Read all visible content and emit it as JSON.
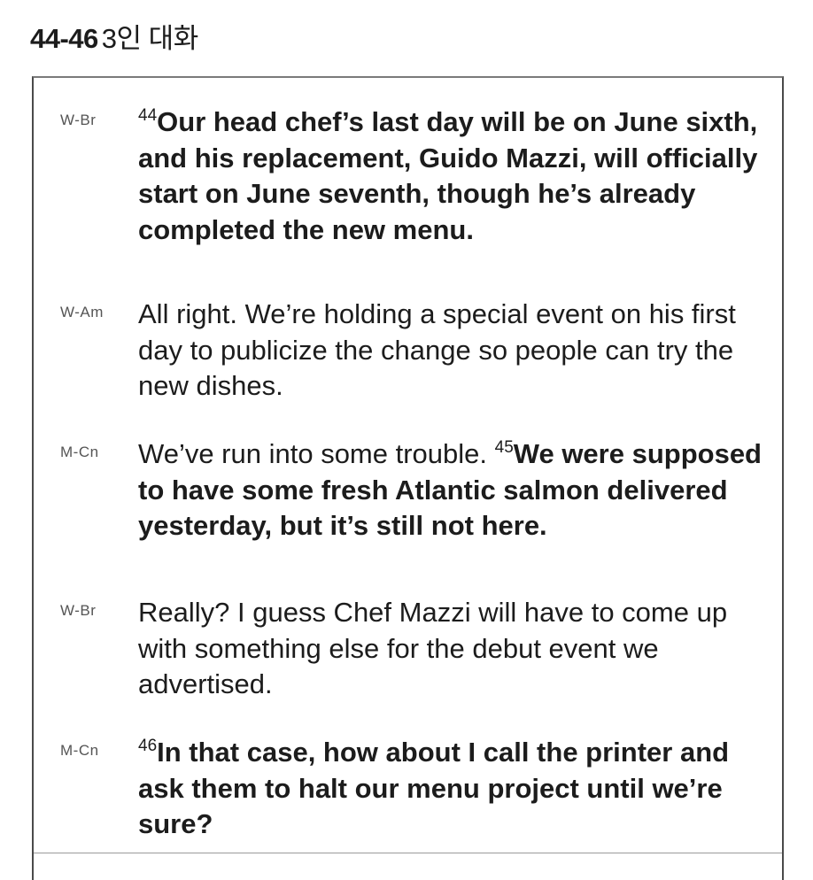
{
  "heading": {
    "number": "44-46",
    "title": "3인 대화"
  },
  "dialogue": [
    {
      "speaker": "W-Br",
      "ref": "44",
      "bold": "Our head chef’s last day will be on June sixth, and his replacement, Guido Mazzi, will officially start on June seventh, though he’s already completed the new menu.",
      "regular_before": "",
      "regular_after": ""
    },
    {
      "speaker": "W-Am",
      "ref": "",
      "bold": "",
      "regular_before": "All right. We’re holding a special event on his first day to publicize the change so people can try the new dishes.",
      "regular_after": ""
    },
    {
      "speaker": "M-Cn",
      "ref": "45",
      "bold": "We were supposed to have some fresh Atlantic salmon delivered yesterday, but it’s still not here.",
      "regular_before": "We’ve run into some trouble. ",
      "regular_after": ""
    },
    {
      "speaker": "W-Br",
      "ref": "",
      "bold": "",
      "regular_before": "Really? I guess Chef Mazzi will have to come up with something else for the debut event we advertised.",
      "regular_after": ""
    },
    {
      "speaker": "M-Cn",
      "ref": "46",
      "bold": "In that case, how about I call the printer and ask them to halt our menu project until we’re sure?",
      "regular_before": "",
      "regular_after": ""
    }
  ]
}
